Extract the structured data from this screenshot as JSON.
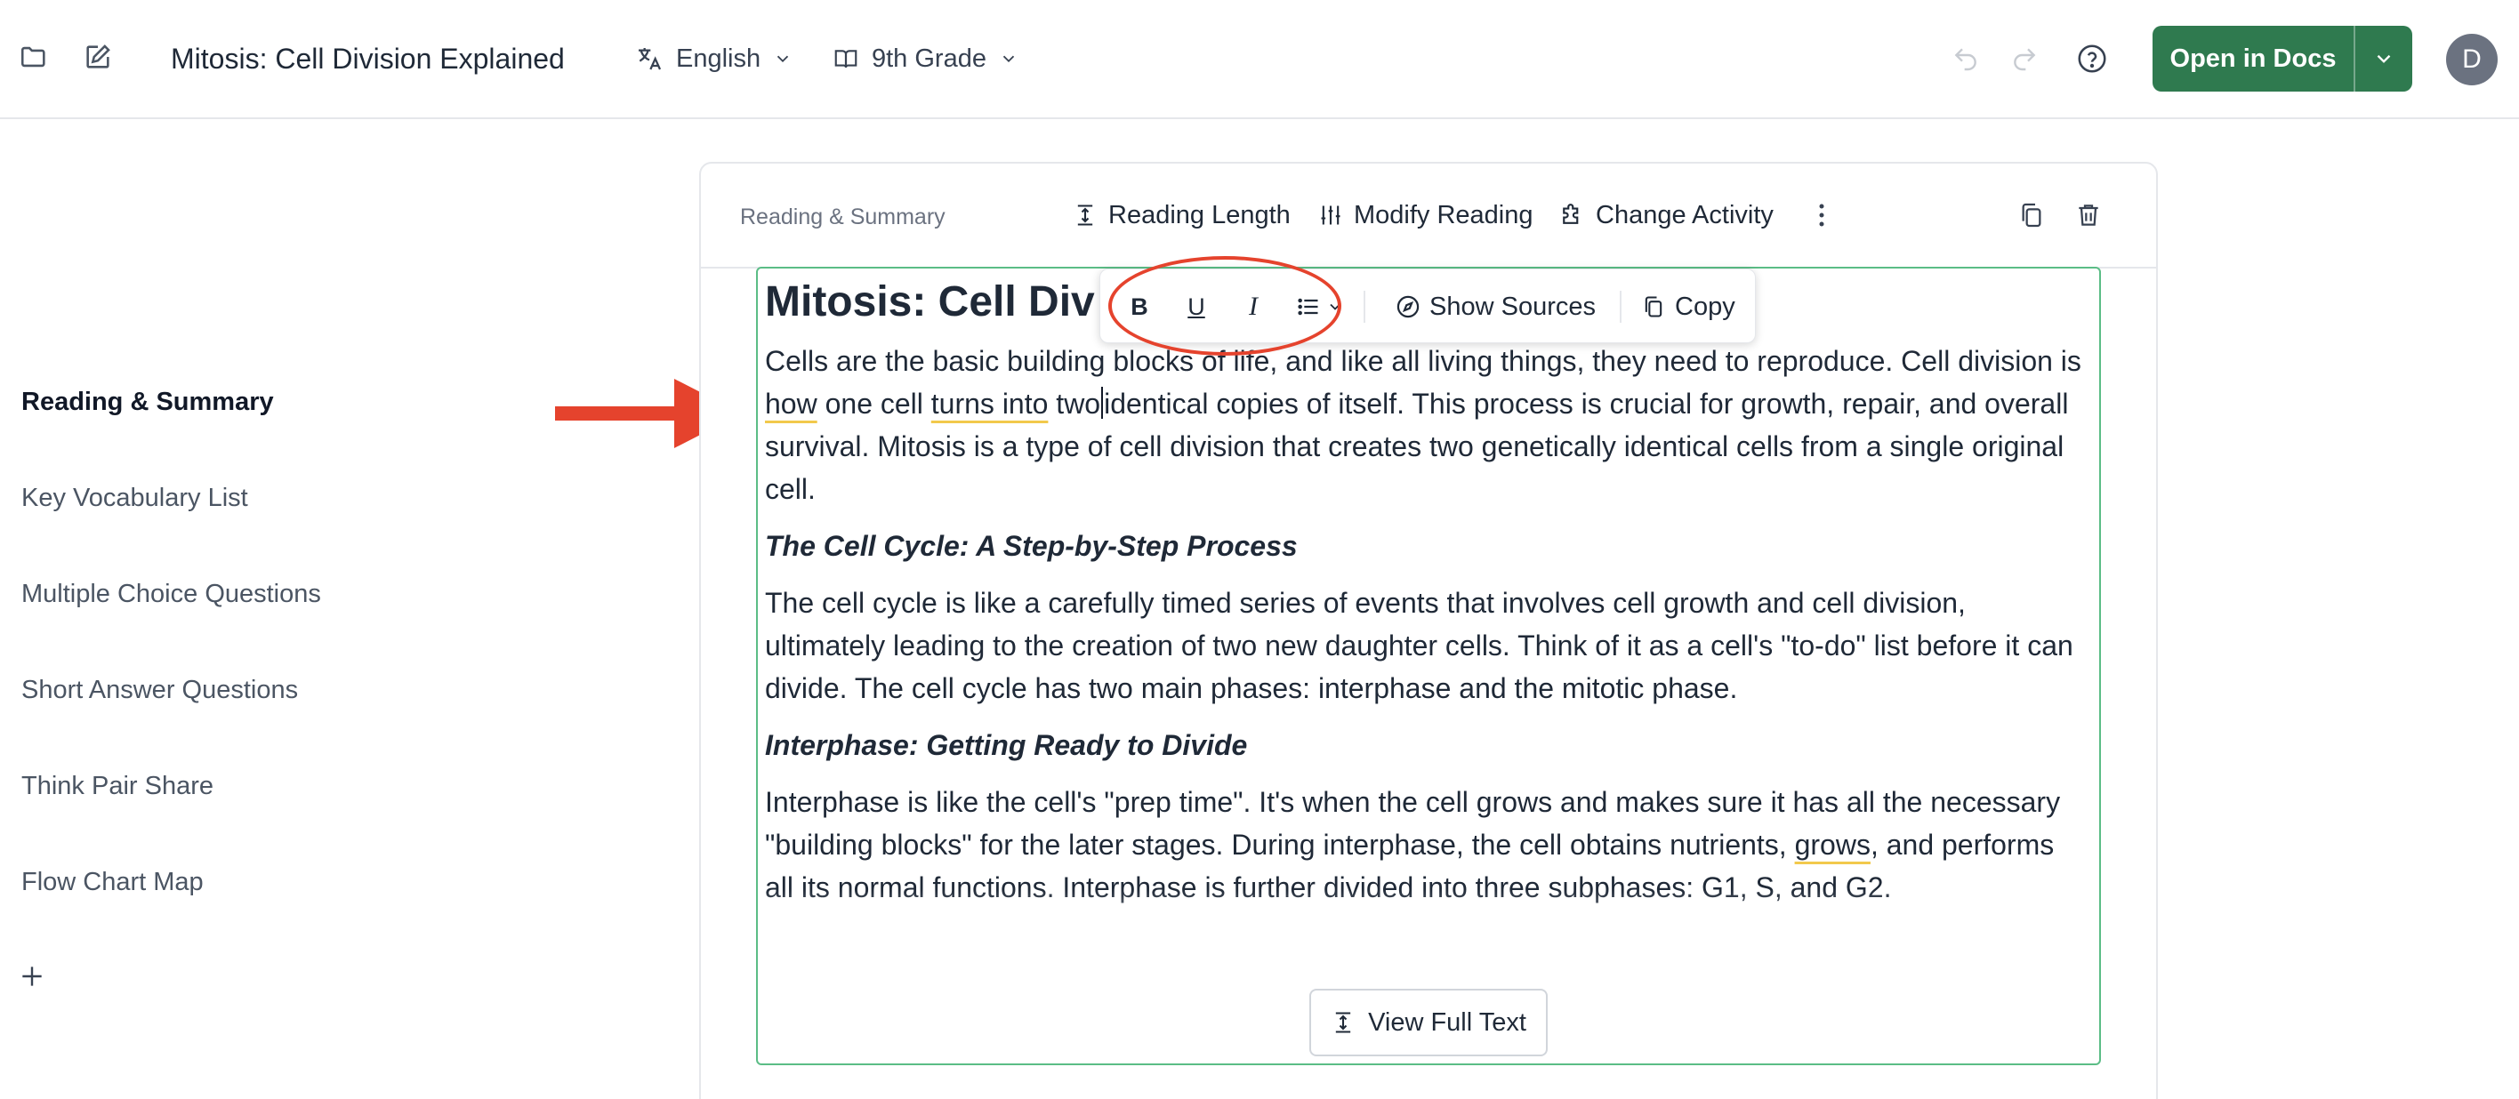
{
  "topbar": {
    "title": "Mitosis: Cell Division Explained",
    "language": "English",
    "grade": "9th Grade",
    "open_docs_label": "Open in Docs",
    "avatar_initial": "D"
  },
  "sidebar": {
    "items": [
      {
        "label": "Reading & Summary",
        "active": true
      },
      {
        "label": "Key Vocabulary List",
        "active": false
      },
      {
        "label": "Multiple Choice Questions",
        "active": false
      },
      {
        "label": "Short Answer Questions",
        "active": false
      },
      {
        "label": "Think Pair Share",
        "active": false
      },
      {
        "label": "Flow Chart Map",
        "active": false
      }
    ],
    "add_symbol": "+"
  },
  "card": {
    "label": "Reading & Summary",
    "actions": {
      "reading_length": "Reading Length",
      "modify_reading": "Modify Reading",
      "change_activity": "Change Activity"
    }
  },
  "format_toolbar": {
    "bold": "B",
    "underline": "U",
    "italic": "I",
    "show_sources": "Show Sources",
    "copy": "Copy"
  },
  "content": {
    "heading": "Mitosis: Cell Div",
    "p1": {
      "a": "Cells are the basic building blocks of life, and like all living things, they need to reproduce. Cell division is ",
      "b": "how",
      "c": " one cell ",
      "d": "turns into",
      "e": " two",
      "f": "identical copies of itself. This process is crucial for growth, repair, and overall survival. Mitosis is a type of cell division that creates two genetically identical cells from a single original cell."
    },
    "h3_1": "The Cell Cycle: A Step-by-Step Process",
    "p2": "The cell cycle is like a carefully timed series of events that involves cell growth and cell division, ultimately leading to the creation of two new daughter cells. Think of it as a cell's \"to-do\" list before it can divide. The cell cycle has two main phases: interphase and the mitotic phase.",
    "h3_2": "Interphase: Getting Ready to Divide",
    "p3": {
      "a": "Interphase is like the cell's \"prep time\". It's when the cell grows and makes sure it has all the necessary \"building blocks\" for the later stages. During interphase, the cell obtains nutrients, ",
      "b": "grows",
      "c": ", and performs all its normal functions. Interphase is further divided into three subphases: G1, S, and G2."
    },
    "view_full_text": "View Full Text"
  },
  "colors": {
    "primary_green": "#2f7a4f",
    "annotation_red": "#e5432d",
    "content_border": "#5bbd86"
  }
}
